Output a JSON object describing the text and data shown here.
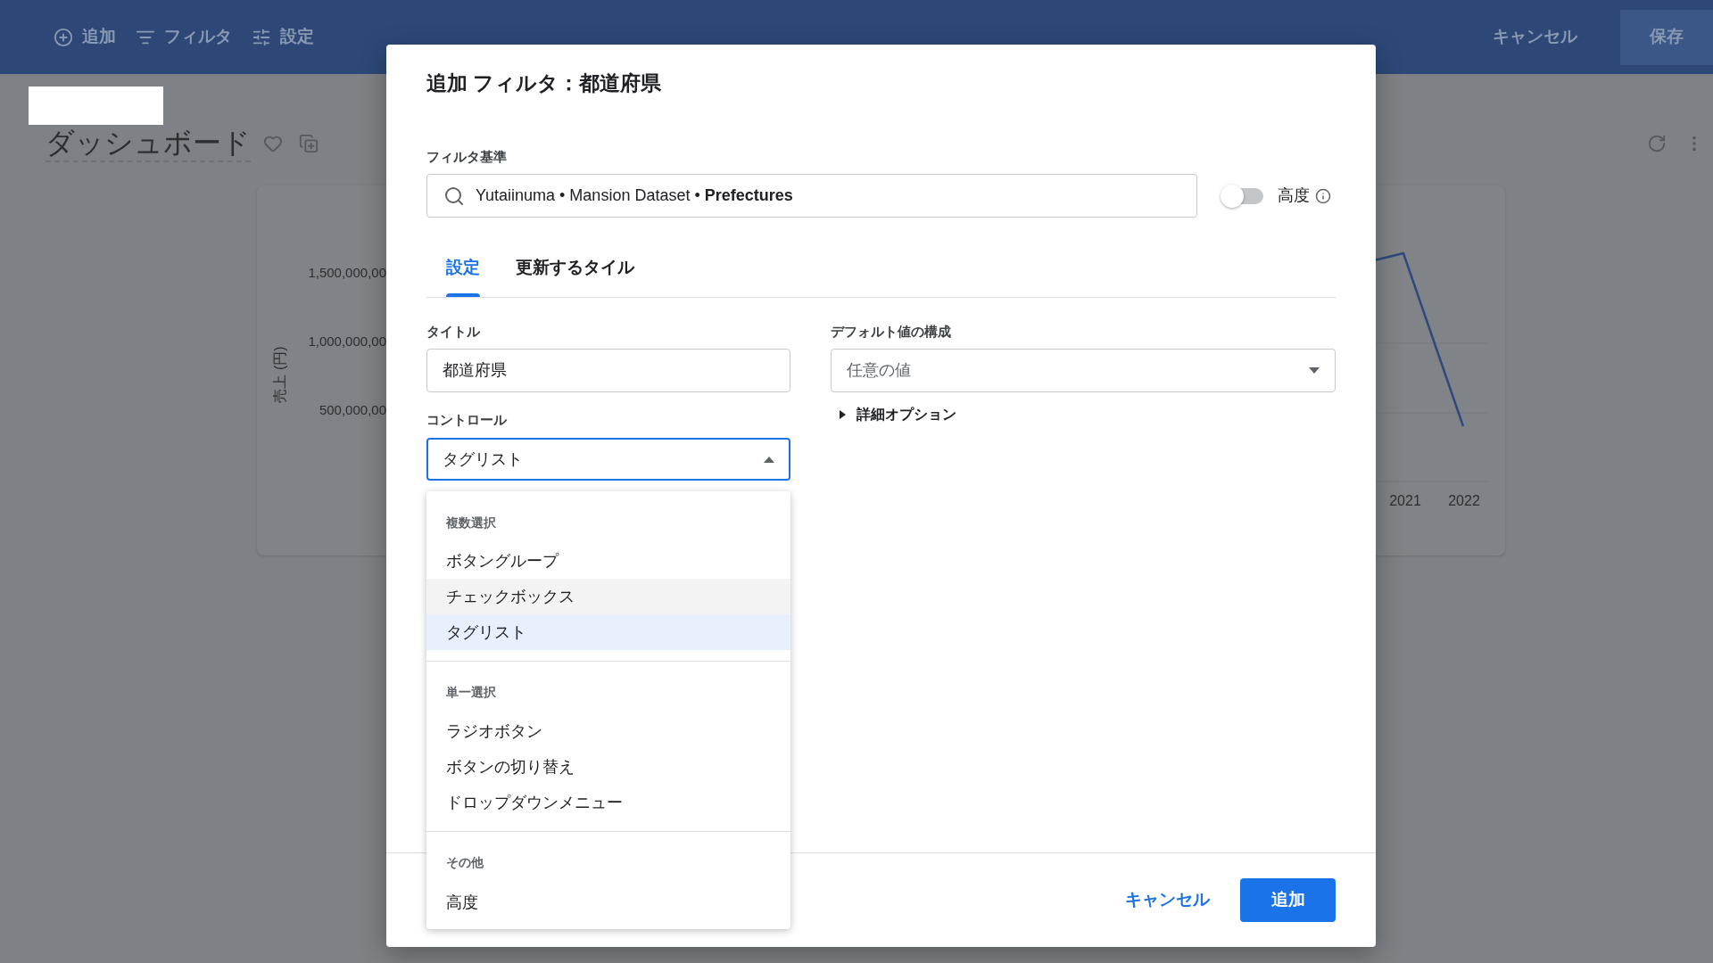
{
  "toolbar": {
    "items": [
      {
        "kind": "add",
        "label": "追加"
      },
      {
        "kind": "filter",
        "label": "フィルタ"
      },
      {
        "kind": "settings",
        "label": "設定"
      }
    ],
    "cancel": "キャンセル",
    "save": "保存"
  },
  "dashboard": {
    "title": "ダッシュボード"
  },
  "chart": {
    "y_axis_title": "売上 (円)",
    "y_tick_labels": [
      "1,500,000,00",
      "1,000,000,00",
      "500,000,00"
    ],
    "x_tick_labels": [
      "2021",
      "2022"
    ]
  },
  "dialog": {
    "title": "追加 フィルタ：都道府県",
    "filter_field": {
      "label": "フィルタ基準",
      "value": "Yutaiinuma • Mansion Dataset • **Prefectures**"
    },
    "advanced": {
      "label": "高度",
      "on": false
    },
    "tabs": [
      {
        "label": "設定",
        "selected": true
      },
      {
        "label": "更新するタイル",
        "selected": false
      }
    ],
    "title_field": {
      "label": "タイトル",
      "value": "都道府県"
    },
    "control_field": {
      "label": "コントロール",
      "value": "タグリスト",
      "expanded": true
    },
    "default_field": {
      "label": "デフォルト値の構成",
      "value": "任意の値",
      "expanded": false
    },
    "details": {
      "label": "詳細オプション",
      "expanded": false
    },
    "menu": [
      {
        "header": "複数選択",
        "items": [
          {
            "label": "ボタングループ",
            "highlighted": false,
            "selected": false
          },
          {
            "label": "チェックボックス",
            "highlighted": true,
            "selected": false
          },
          {
            "label": "タグリスト",
            "highlighted": false,
            "selected": true
          }
        ]
      },
      {
        "header": "単一選択",
        "items": [
          {
            "label": "ラジオボタン",
            "highlighted": false,
            "selected": false
          },
          {
            "label": "ボタンの切り替え",
            "highlighted": false,
            "selected": false
          },
          {
            "label": "ドロップダウンメニュー",
            "highlighted": false,
            "selected": false
          }
        ]
      },
      {
        "header": "その他",
        "items": [
          {
            "label": "高度",
            "highlighted": false,
            "selected": false
          }
        ]
      }
    ],
    "cancel": "キャンセル",
    "submit": "追加"
  }
}
